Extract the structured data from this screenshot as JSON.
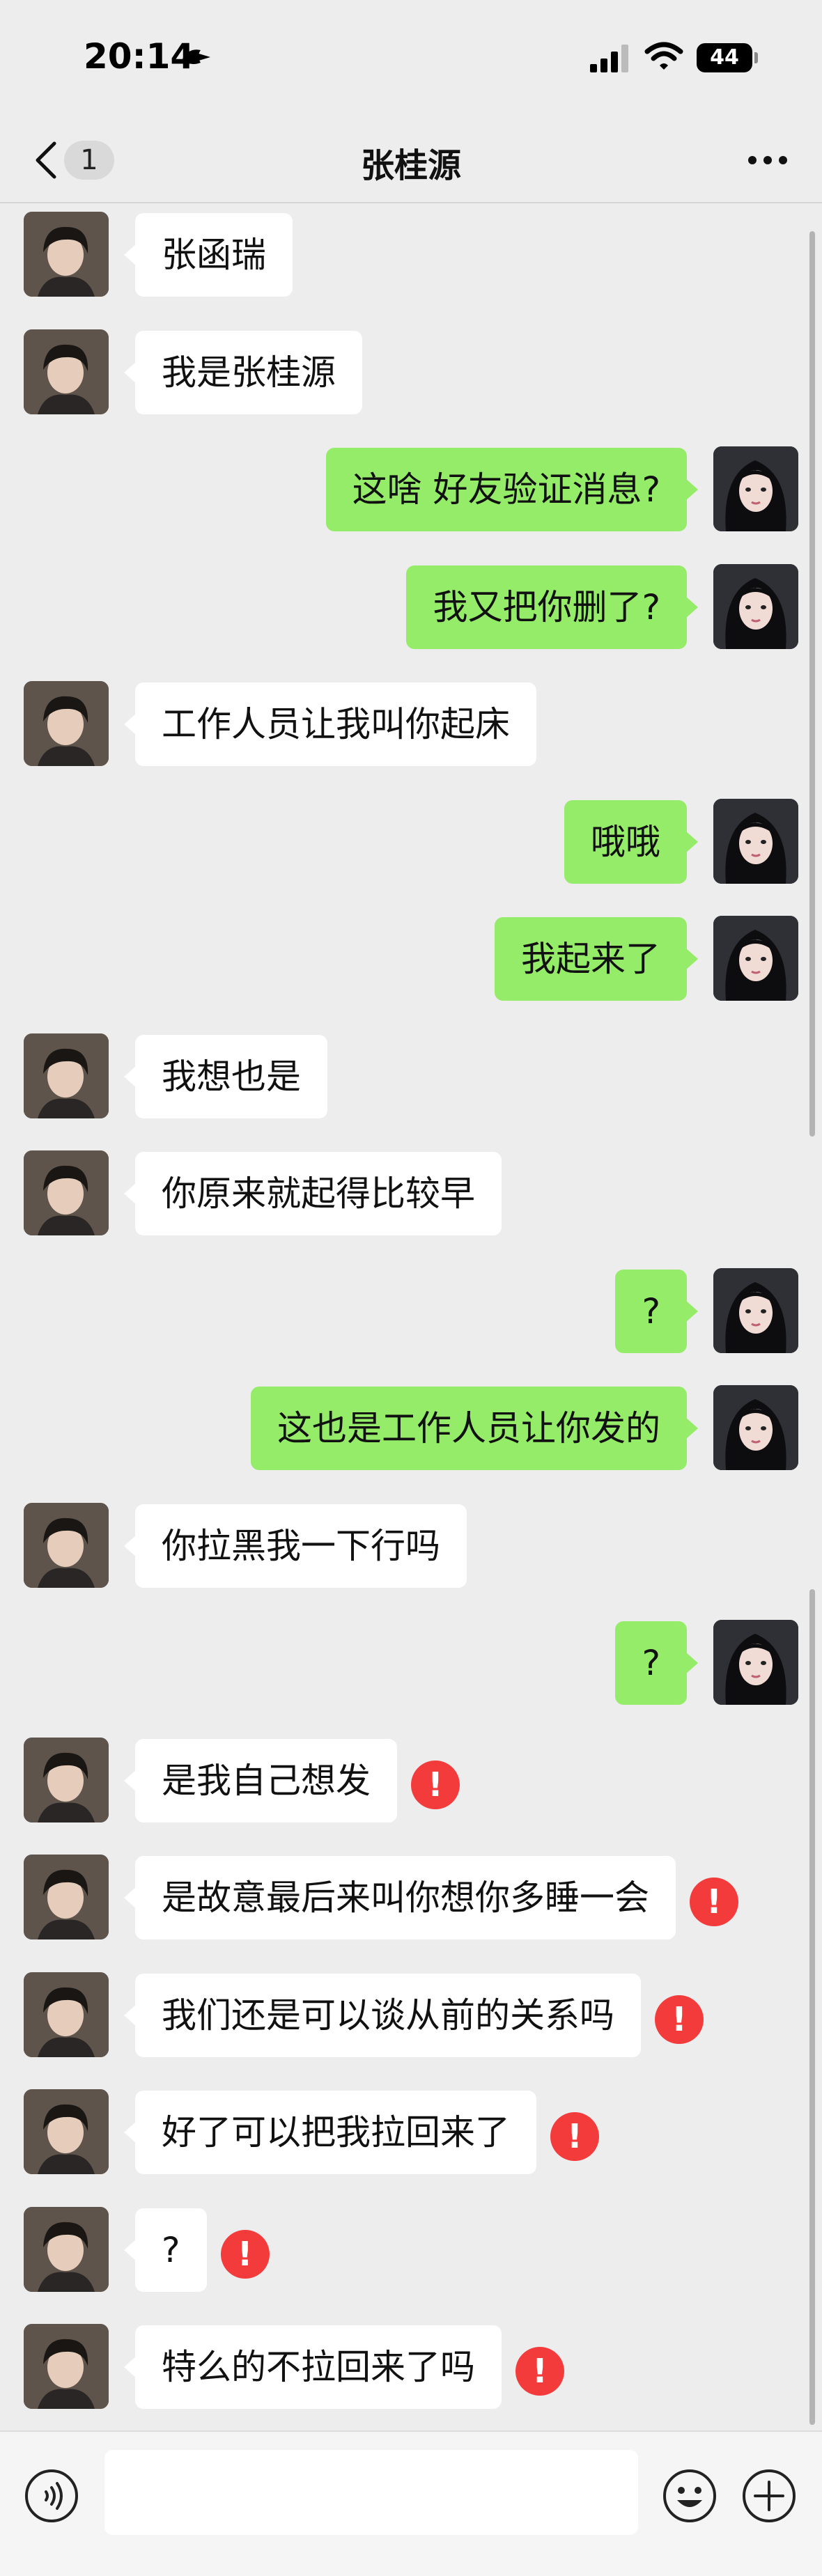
{
  "status_bar": {
    "time": "20:14",
    "battery": "44"
  },
  "header": {
    "title": "张桂源",
    "unread_count": "1"
  },
  "messages": [
    {
      "side": "left",
      "text": "张函瑞",
      "error": false
    },
    {
      "side": "left",
      "text": "我是张桂源",
      "error": false
    },
    {
      "side": "right",
      "text": "这啥 好友验证消息?",
      "error": false
    },
    {
      "side": "right",
      "text": "我又把你删了?",
      "error": false
    },
    {
      "side": "left",
      "text": "工作人员让我叫你起床",
      "error": false
    },
    {
      "side": "right",
      "text": "哦哦",
      "error": false
    },
    {
      "side": "right",
      "text": "我起来了",
      "error": false
    },
    {
      "side": "left",
      "text": "我想也是",
      "error": false
    },
    {
      "side": "left",
      "text": "你原来就起得比较早",
      "error": false
    },
    {
      "side": "right",
      "text": "?",
      "error": false
    },
    {
      "side": "right",
      "text": "这也是工作人员让你发的",
      "error": false
    },
    {
      "side": "left",
      "text": "你拉黑我一下行吗",
      "error": false
    },
    {
      "side": "right",
      "text": "?",
      "error": false
    },
    {
      "side": "left",
      "text": "是我自己想发",
      "error": true
    },
    {
      "side": "left",
      "text": "是故意最后来叫你想你多睡一会",
      "error": true
    },
    {
      "side": "left",
      "text": "我们还是可以谈从前的关系吗",
      "error": true
    },
    {
      "side": "left",
      "text": "好了可以把我拉回来了",
      "error": true
    },
    {
      "side": "left",
      "text": "?",
      "error": true
    },
    {
      "side": "left",
      "text": "特么的不拉回来了吗",
      "error": true
    }
  ],
  "input": {
    "placeholder": ""
  },
  "colors": {
    "sent_bubble": "#95ec69",
    "received_bubble": "#ffffff",
    "error": "#f43b3b",
    "background": "#ededed"
  }
}
